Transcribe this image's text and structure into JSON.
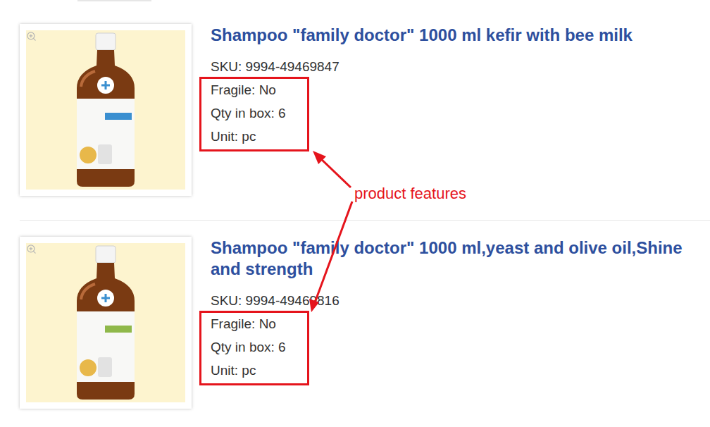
{
  "products": [
    {
      "title": "Shampoo \"family doctor\" 1000 ml kefir with bee milk",
      "sku": "SKU: 9994-49469847",
      "features": [
        "Fragile: No",
        "Qty in box: 6",
        "Unit: pc"
      ],
      "highlighted": true,
      "label_color": "#3a8fd0"
    },
    {
      "title": "Shampoo \"family doctor\" 1000 ml,yeast and olive oil,Shine and strength",
      "sku": "SKU: 9994-49469816",
      "features": [
        "Fragile: No",
        "Qty in box: 6",
        "Unit: pc"
      ],
      "highlighted": true,
      "label_color": "#8fb84a"
    }
  ],
  "annotation": {
    "label": "product features"
  }
}
